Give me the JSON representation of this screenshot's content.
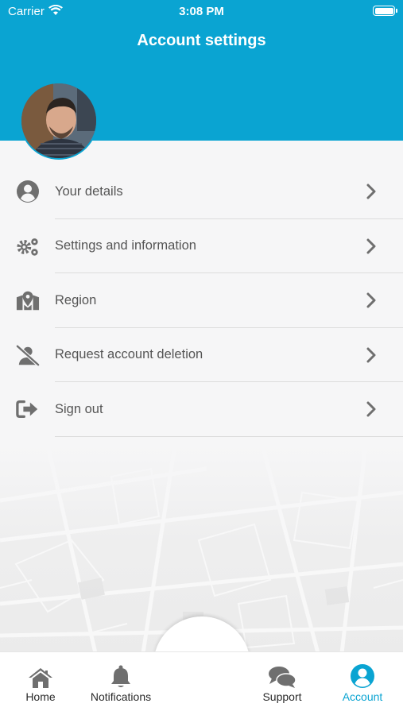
{
  "status_bar": {
    "carrier": "Carrier",
    "time": "3:08 PM"
  },
  "header": {
    "title": "Account settings"
  },
  "menu": {
    "items": [
      {
        "label": "Your details",
        "icon": "user-circle-icon"
      },
      {
        "label": "Settings and information",
        "icon": "gears-icon"
      },
      {
        "label": "Region",
        "icon": "map-pin-icon"
      },
      {
        "label": "Request account deletion",
        "icon": "user-slash-icon"
      },
      {
        "label": "Sign out",
        "icon": "sign-out-icon"
      }
    ]
  },
  "tabs": [
    {
      "label": "Home",
      "icon": "home-icon",
      "active": false
    },
    {
      "label": "Notifications",
      "icon": "bell-icon",
      "active": false
    },
    {
      "label": "Support",
      "icon": "chat-bubbles-icon",
      "active": false
    },
    {
      "label": "Account",
      "icon": "user-circle-icon",
      "active": true
    }
  ],
  "colors": {
    "accent": "#0aa4d2",
    "icon_gray": "#6f6f6f",
    "text_gray": "#555555"
  }
}
